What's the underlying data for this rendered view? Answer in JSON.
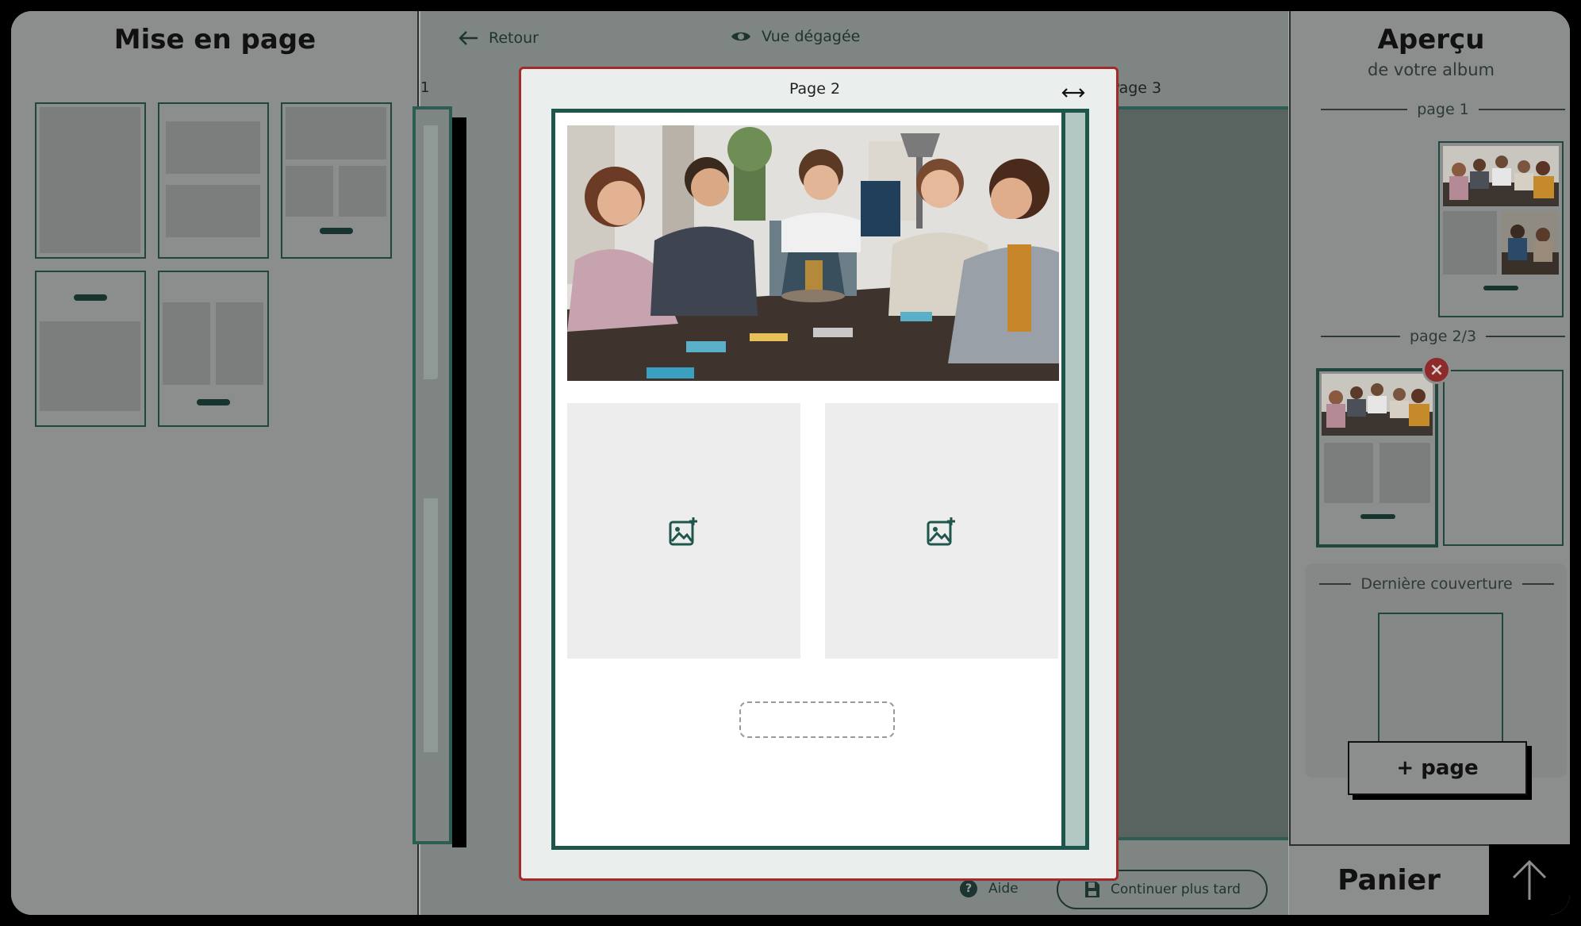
{
  "left_panel": {
    "title": "Mise en page"
  },
  "toolbar": {
    "back_label": "Retour",
    "view_label": "Vue dégagée"
  },
  "editor": {
    "page_left_label": "1",
    "page_right_label": "Page 3"
  },
  "modal": {
    "title": "Page 2"
  },
  "right_panel": {
    "title": "Aperçu",
    "subtitle": "de votre album",
    "section_page1": "page 1",
    "section_page23": "page 2/3",
    "section_cover": "Dernière couverture",
    "add_page_label": "+ page"
  },
  "footer": {
    "help_label": "Aide",
    "help_glyph": "?",
    "continue_later_label": "Continuer plus tard"
  },
  "cart": {
    "label": "Panier"
  },
  "icons": {
    "close": "×",
    "back": "arrow-left-icon",
    "view": "eye-icon",
    "add_image": "image-add-icon",
    "save": "floppy-icon",
    "up": "arrow-up-icon",
    "resize": "resize-horizontal-icon"
  },
  "colors": {
    "accent": "#1e564b",
    "modal_border": "#a32a2a",
    "overlay": "#8b8e8c"
  }
}
